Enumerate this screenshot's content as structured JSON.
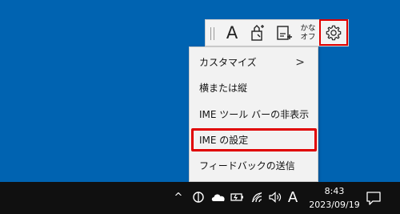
{
  "ime_toolbar": {
    "font_glyph": "A",
    "kana_line1": "かな",
    "kana_line2": "オフ",
    "icons": [
      "grip-icon",
      "font-icon",
      "draw-pad-icon",
      "ime-pad-icon",
      "kana-toggle",
      "gear-icon"
    ]
  },
  "menu": {
    "items": [
      {
        "label": "カスタマイズ",
        "has_submenu": true,
        "arrow": ">"
      },
      {
        "label": "横または縦"
      },
      {
        "label": "IME ツール バーの非表示"
      },
      {
        "label": "IME の設定",
        "highlighted": true
      },
      {
        "label": "フィードバックの送信"
      }
    ]
  },
  "taskbar": {
    "chevron": "^",
    "ime_glyph": "A",
    "time": "8:43",
    "date": "2023/09/19"
  },
  "colors": {
    "desktop": "#0063b1",
    "taskbar": "#101010",
    "highlight": "#e00000",
    "menu_bg": "#f2f2f2"
  }
}
